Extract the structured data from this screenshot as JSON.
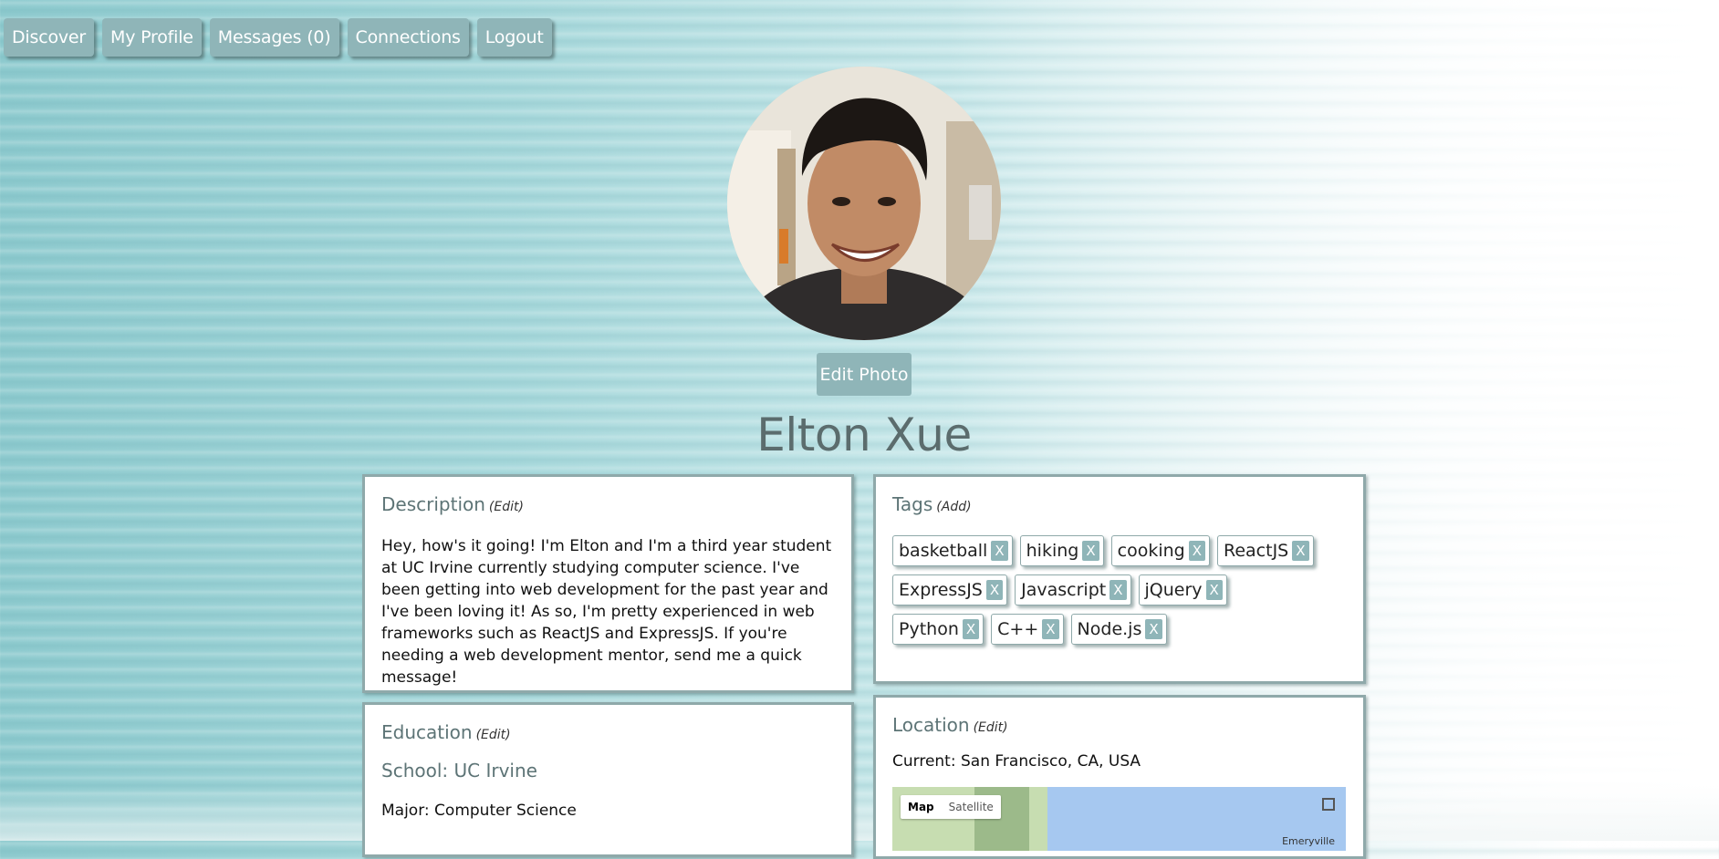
{
  "nav": {
    "items": [
      "Discover",
      "My Profile",
      "Messages (0)",
      "Connections",
      "Logout"
    ]
  },
  "profile": {
    "edit_photo_label": "Edit Photo",
    "name": "Elton Xue"
  },
  "description": {
    "title": "Description",
    "edit_label": "(Edit)",
    "text": "Hey, how's it going! I'm Elton and I'm a third year student at UC Irvine currently studying computer science. I've been getting into web development for the past year and I've been loving it! As so, I'm pretty experienced in web frameworks such as ReactJS and ExpressJS. If you're needing a web development mentor, send me a quick message!"
  },
  "tags": {
    "title": "Tags",
    "add_label": "(Add)",
    "remove_label": "X",
    "items": [
      "basketball",
      "hiking",
      "cooking",
      "ReactJS",
      "ExpressJS",
      "Javascript",
      "jQuery",
      "Python",
      "C++",
      "Node.js"
    ]
  },
  "education": {
    "title": "Education",
    "edit_label": "(Edit)",
    "school_label": "School:",
    "school": "UC Irvine",
    "major_label": "Major:",
    "major": "Computer Science"
  },
  "location": {
    "title": "Location",
    "edit_label": "(Edit)",
    "current_label": "Current:",
    "current": "San Francisco, CA, USA",
    "map_label": "Map",
    "satellite_label": "Satellite",
    "city_label": "Emeryville"
  },
  "colors": {
    "button_bg": "#8fb5b8",
    "panel_border": "#8fa9aa",
    "heading_text": "#5d7476"
  }
}
